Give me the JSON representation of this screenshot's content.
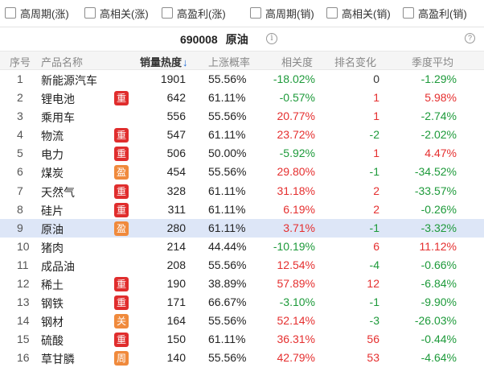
{
  "filters": [
    {
      "label": "高周期(涨)",
      "checked": false
    },
    {
      "label": "高相关(涨)",
      "checked": false
    },
    {
      "label": "高盈利(涨)",
      "checked": false
    },
    {
      "label": "高周期(销)",
      "checked": false
    },
    {
      "label": "高相关(销)",
      "checked": false
    },
    {
      "label": "高盈利(销)",
      "checked": false
    }
  ],
  "title": {
    "code": "690008",
    "name": "原油"
  },
  "columns": {
    "no": "序号",
    "name": "产品名称",
    "hot": "销量热度",
    "hot_sort": "↓",
    "prob": "上涨概率",
    "corr": "相关度",
    "rank": "排名变化",
    "season": "季度平均"
  },
  "colors": {
    "up": "#e52f2f",
    "down": "#1d9a3a",
    "badge_red": "#e02d2d",
    "badge_orange": "#f08a3c",
    "selected": "#dde6f7"
  },
  "selected_row": 9,
  "rows": [
    {
      "no": "1",
      "name": "新能源汽车",
      "badge": "",
      "hot": "1901",
      "prob": "55.56%",
      "corr": "-18.02%",
      "rank": "0",
      "season": "-1.29%"
    },
    {
      "no": "2",
      "name": "锂电池",
      "badge": "重",
      "hot": "642",
      "prob": "61.11%",
      "corr": "-0.57%",
      "rank": "1",
      "season": "5.98%"
    },
    {
      "no": "3",
      "name": "乘用车",
      "badge": "",
      "hot": "556",
      "prob": "55.56%",
      "corr": "20.77%",
      "rank": "1",
      "season": "-2.74%"
    },
    {
      "no": "4",
      "name": "物流",
      "badge": "重",
      "hot": "547",
      "prob": "61.11%",
      "corr": "23.72%",
      "rank": "-2",
      "season": "-2.02%"
    },
    {
      "no": "5",
      "name": "电力",
      "badge": "重",
      "hot": "506",
      "prob": "50.00%",
      "corr": "-5.92%",
      "rank": "1",
      "season": "4.47%"
    },
    {
      "no": "6",
      "name": "煤炭",
      "badge": "盈",
      "hot": "454",
      "prob": "55.56%",
      "corr": "29.80%",
      "rank": "-1",
      "season": "-34.52%"
    },
    {
      "no": "7",
      "name": "天然气",
      "badge": "重",
      "hot": "328",
      "prob": "61.11%",
      "corr": "31.18%",
      "rank": "2",
      "season": "-33.57%"
    },
    {
      "no": "8",
      "name": "硅片",
      "badge": "重",
      "hot": "311",
      "prob": "61.11%",
      "corr": "6.19%",
      "rank": "2",
      "season": "-0.26%"
    },
    {
      "no": "9",
      "name": "原油",
      "badge": "盈",
      "hot": "280",
      "prob": "61.11%",
      "corr": "3.71%",
      "rank": "-1",
      "season": "-3.32%"
    },
    {
      "no": "10",
      "name": "猪肉",
      "badge": "",
      "hot": "214",
      "prob": "44.44%",
      "corr": "-10.19%",
      "rank": "6",
      "season": "11.12%"
    },
    {
      "no": "11",
      "name": "成品油",
      "badge": "",
      "hot": "208",
      "prob": "55.56%",
      "corr": "12.54%",
      "rank": "-4",
      "season": "-0.66%"
    },
    {
      "no": "12",
      "name": "稀土",
      "badge": "重",
      "hot": "190",
      "prob": "38.89%",
      "corr": "57.89%",
      "rank": "12",
      "season": "-6.84%"
    },
    {
      "no": "13",
      "name": "钢铁",
      "badge": "重",
      "hot": "171",
      "prob": "66.67%",
      "corr": "-3.10%",
      "rank": "-1",
      "season": "-9.90%"
    },
    {
      "no": "14",
      "name": "钢材",
      "badge": "关",
      "hot": "164",
      "prob": "55.56%",
      "corr": "52.14%",
      "rank": "-3",
      "season": "-26.03%"
    },
    {
      "no": "15",
      "name": "硫酸",
      "badge": "重",
      "hot": "150",
      "prob": "61.11%",
      "corr": "36.31%",
      "rank": "56",
      "season": "-0.44%"
    },
    {
      "no": "16",
      "name": "草甘膦",
      "badge": "周",
      "hot": "140",
      "prob": "55.56%",
      "corr": "42.79%",
      "rank": "53",
      "season": "-4.64%"
    }
  ]
}
